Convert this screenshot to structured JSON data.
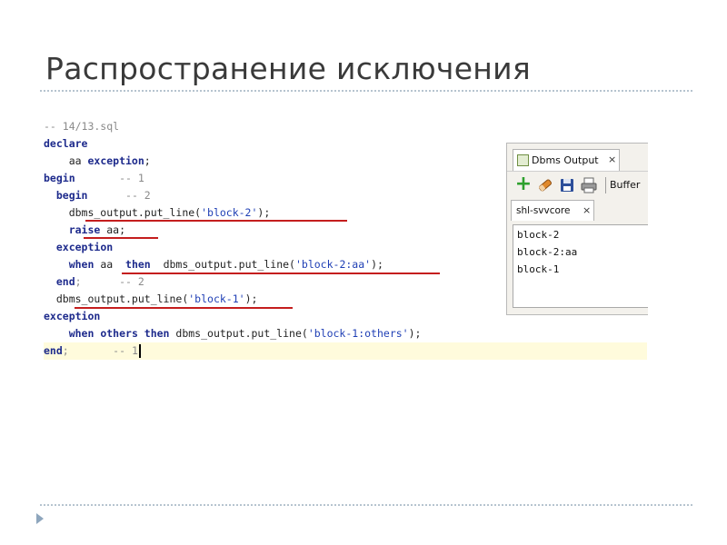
{
  "slide": {
    "title": "Распространение исключения"
  },
  "code": {
    "lines": [
      [
        {
          "t": "-- 14/13.sql",
          "c": "cm"
        }
      ],
      [
        {
          "t": "declare",
          "c": "kw"
        }
      ],
      [
        {
          "t": "    aa ",
          "c": "pl"
        },
        {
          "t": "exception",
          "c": "kw"
        },
        {
          "t": ";",
          "c": "pl"
        }
      ],
      [
        {
          "t": "begin",
          "c": "kw"
        },
        {
          "t": "       -- 1",
          "c": "cm"
        }
      ],
      [
        {
          "t": "  ",
          "c": "pl"
        },
        {
          "t": "begin",
          "c": "kw"
        },
        {
          "t": "      -- 2",
          "c": "cm"
        }
      ],
      [
        {
          "t": "    dbms_output.put_line(",
          "c": "pl"
        },
        {
          "t": "'block-2'",
          "c": "st"
        },
        {
          "t": ");",
          "c": "pl"
        }
      ],
      [
        {
          "t": "    ",
          "c": "pl"
        },
        {
          "t": "raise",
          "c": "kw"
        },
        {
          "t": " aa;",
          "c": "pl"
        }
      ],
      [
        {
          "t": "  ",
          "c": "pl"
        },
        {
          "t": "exception",
          "c": "kw"
        }
      ],
      [
        {
          "t": "    ",
          "c": "pl"
        },
        {
          "t": "when",
          "c": "kw"
        },
        {
          "t": " aa  ",
          "c": "pl"
        },
        {
          "t": "then",
          "c": "kw"
        },
        {
          "t": "  dbms_output.put_line(",
          "c": "pl"
        },
        {
          "t": "'block-2:aa'",
          "c": "st"
        },
        {
          "t": ");",
          "c": "pl"
        }
      ],
      [
        {
          "t": "  ",
          "c": "pl"
        },
        {
          "t": "end",
          "c": "kw"
        },
        {
          "t": ";      -- 2",
          "c": "cm"
        }
      ],
      [
        {
          "t": "  dbms_output.put_line(",
          "c": "pl"
        },
        {
          "t": "'block-1'",
          "c": "st"
        },
        {
          "t": ");",
          "c": "pl"
        }
      ],
      [
        {
          "t": "exception",
          "c": "kw"
        }
      ],
      [
        {
          "t": "    ",
          "c": "pl"
        },
        {
          "t": "when others then",
          "c": "kw"
        },
        {
          "t": " dbms_output.put_line(",
          "c": "pl"
        },
        {
          "t": "'block-1:others'",
          "c": "st"
        },
        {
          "t": ");",
          "c": "pl"
        }
      ],
      [
        {
          "t": "end",
          "c": "kw"
        },
        {
          "t": ";       -- 1",
          "c": "cm"
        }
      ]
    ],
    "current_line": 13
  },
  "panel": {
    "tab_label": "Dbms Output",
    "tab_close": "×",
    "toolbar_label": "Buffer",
    "connection_tab": "shl-svvcore",
    "output_lines": [
      "block-2",
      "block-2:aa",
      "block-1"
    ],
    "icons": [
      "add-icon",
      "eraser-icon",
      "save-icon",
      "print-icon"
    ]
  },
  "colors": {
    "underline": "#c41e1e",
    "current_line": "#fffbdc",
    "keyword": "#1d2a8c"
  }
}
